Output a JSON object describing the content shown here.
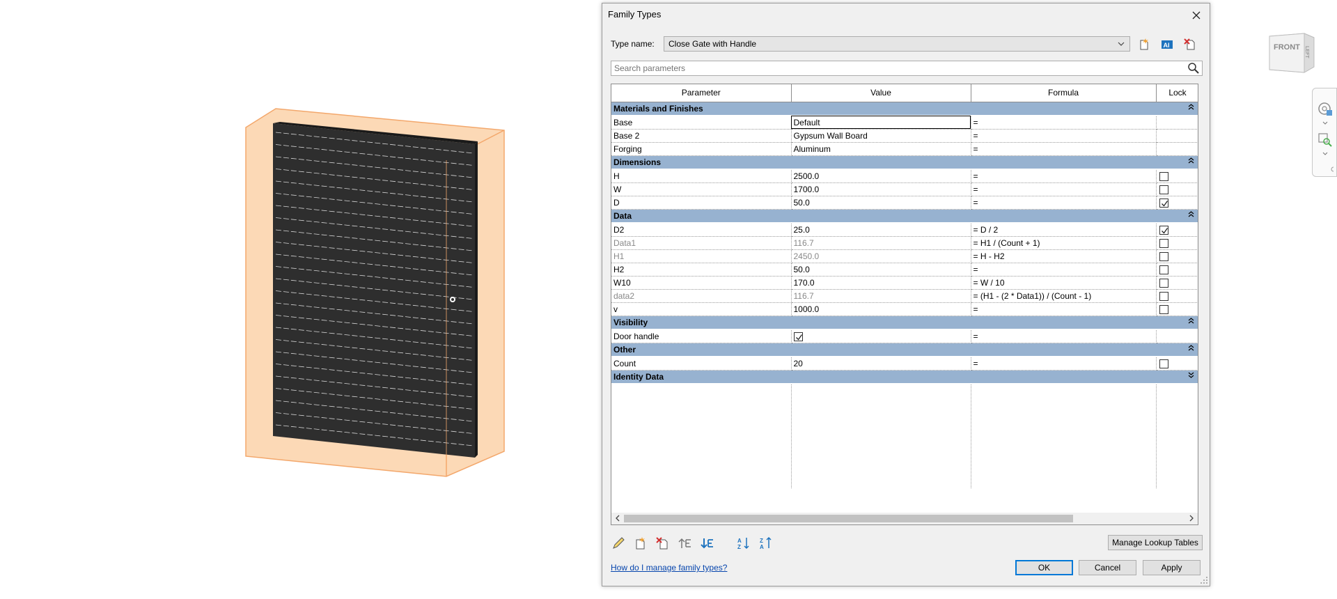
{
  "dialog": {
    "title": "Family Types",
    "type_name_label": "Type name:",
    "type_name_value": "Close Gate with Handle",
    "search_placeholder": "Search parameters",
    "columns": [
      "Parameter",
      "Value",
      "Formula",
      "Lock"
    ],
    "groups": [
      {
        "name": "Materials and Finishes",
        "expanded": true,
        "rows": [
          {
            "name": "Base",
            "value": "Default",
            "formula": "=",
            "lock": null,
            "editing": true
          },
          {
            "name": "Base 2",
            "value": "Gypsum Wall Board",
            "formula": "=",
            "lock": null
          },
          {
            "name": "Forging",
            "value": "Aluminum",
            "formula": "=",
            "lock": null
          }
        ]
      },
      {
        "name": "Dimensions",
        "expanded": true,
        "rows": [
          {
            "name": "H",
            "value": "2500.0",
            "formula": "=",
            "lock": false
          },
          {
            "name": "W",
            "value": "1700.0",
            "formula": "=",
            "lock": false
          },
          {
            "name": "D",
            "value": "50.0",
            "formula": "=",
            "lock": true
          }
        ]
      },
      {
        "name": "Data",
        "expanded": true,
        "rows": [
          {
            "name": "D2",
            "value": "25.0",
            "formula": "= D / 2",
            "lock": true
          },
          {
            "name": "Data1",
            "value": "116.7",
            "formula": "= H1 / (Count + 1)",
            "lock": false,
            "computed": true
          },
          {
            "name": "H1",
            "value": "2450.0",
            "formula": "= H - H2",
            "lock": false,
            "computed": true
          },
          {
            "name": "H2",
            "value": "50.0",
            "formula": "=",
            "lock": false
          },
          {
            "name": "W10",
            "value": "170.0",
            "formula": "= W / 10",
            "lock": false
          },
          {
            "name": "data2",
            "value": "116.7",
            "formula": "= (H1 - (2 * Data1)) / (Count - 1)",
            "lock": false,
            "computed": true
          },
          {
            "name": "v",
            "value": "1000.0",
            "formula": "=",
            "lock": false
          }
        ]
      },
      {
        "name": "Visibility",
        "expanded": true,
        "rows": [
          {
            "name": "Door handle",
            "value_checkbox": true,
            "formula": "=",
            "lock": null
          }
        ]
      },
      {
        "name": "Other",
        "expanded": true,
        "rows": [
          {
            "name": "Count",
            "value": "20",
            "formula": "=",
            "lock": false
          }
        ]
      },
      {
        "name": "Identity Data",
        "expanded": false,
        "rows": []
      }
    ],
    "buttons": {
      "manage_lookup": "Manage Lookup Tables",
      "ok": "OK",
      "cancel": "Cancel",
      "apply": "Apply"
    },
    "help_link": "How do I manage family types?"
  },
  "viewcube": {
    "front_label": "FRONT",
    "side_label": "LEFT"
  },
  "colors": {
    "group_header": "#97b2d0",
    "gate_panel": "#2e2e2e",
    "frame_fill": "#fcd9b6",
    "frame_stroke": "#f3a76b",
    "accent": "#0078d7"
  },
  "icons": {
    "toolbar": [
      "new-type-icon",
      "rename-type-icon",
      "delete-type-icon"
    ],
    "bottom": [
      "edit-parameter-icon",
      "new-parameter-icon",
      "delete-parameter-icon",
      "move-up-icon",
      "move-down-icon",
      "sort-ascending-icon",
      "sort-descending-icon"
    ]
  }
}
